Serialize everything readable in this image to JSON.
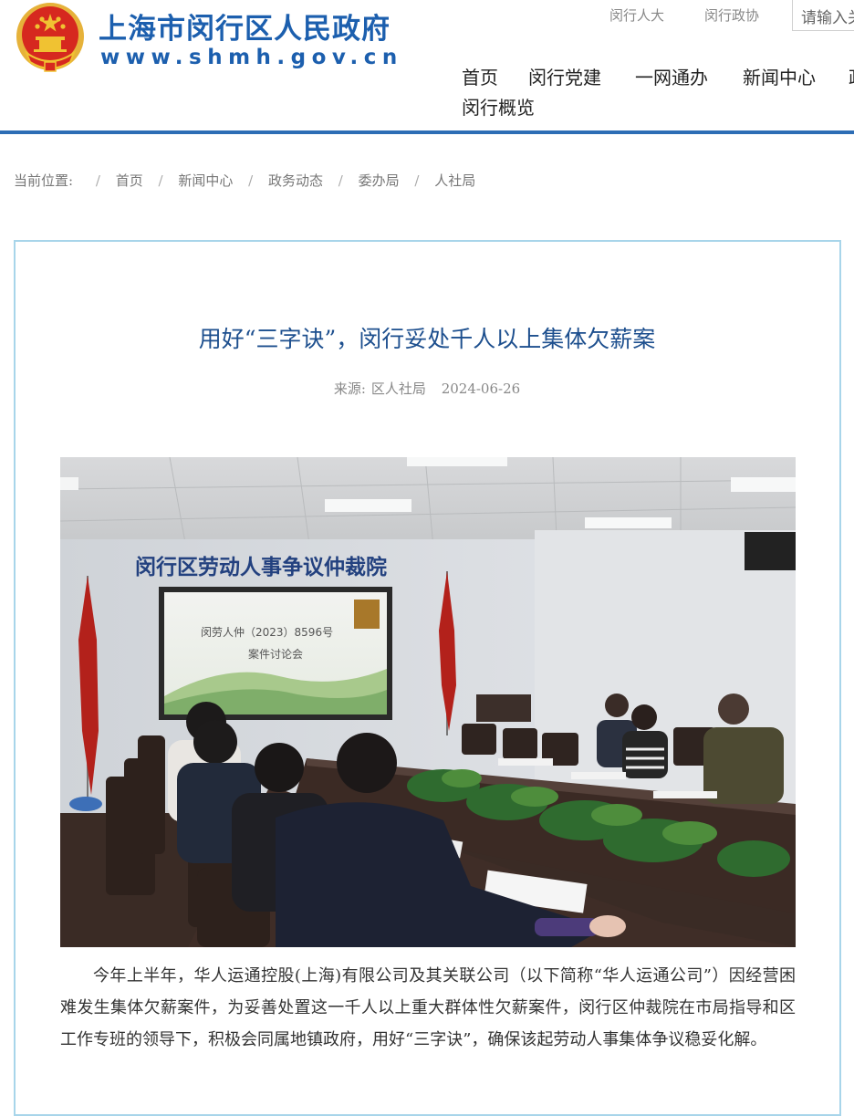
{
  "header": {
    "site_name": "上海市闵行区人民政府",
    "site_domain": "www.shmh.gov.cn",
    "top_links": [
      "闵行人大",
      "闵行政协"
    ],
    "search_placeholder": "请输入关键字",
    "nav": [
      "首页",
      "闵行党建",
      "一网通办",
      "新闻中心",
      "政",
      "闵行概览"
    ]
  },
  "breadcrumb": {
    "label": "当前位置:",
    "items": [
      "首页",
      "新闻中心",
      "政务动态",
      "委办局",
      "人社局"
    ]
  },
  "article": {
    "title": "用好“三字诀”，闵行妥处千人以上集体欠薪案",
    "source_label": "来源:",
    "source": "区人社局",
    "date": "2024-06-26",
    "photo": {
      "wall_sign": "闵行区劳动人事争议仲裁院",
      "screen_line1": "闵劳人仲（2023）8596号",
      "screen_line2": "案件讨论会"
    },
    "paragraph": "今年上半年，华人运通控股(上海)有限公司及其关联公司（以下简称“华人运通公司”）因经营困难发生集体欠薪案件，为妥善处置这一千人以上重大群体性欠薪案件，闵行区仲裁院在市局指导和区工作专班的领导下，积极会同属地镇政府，用好“三字诀”，确保该起劳动人事集体争议稳妥化解。"
  },
  "colors": {
    "brand_blue": "#1c5fae",
    "title_blue": "#1d4f8e",
    "header_rule": "#2d6db5",
    "card_border": "#a8d5ea",
    "emblem_red": "#d6281f",
    "emblem_gold": "#f0c232"
  },
  "icons": [
    "national-emblem-icon"
  ]
}
